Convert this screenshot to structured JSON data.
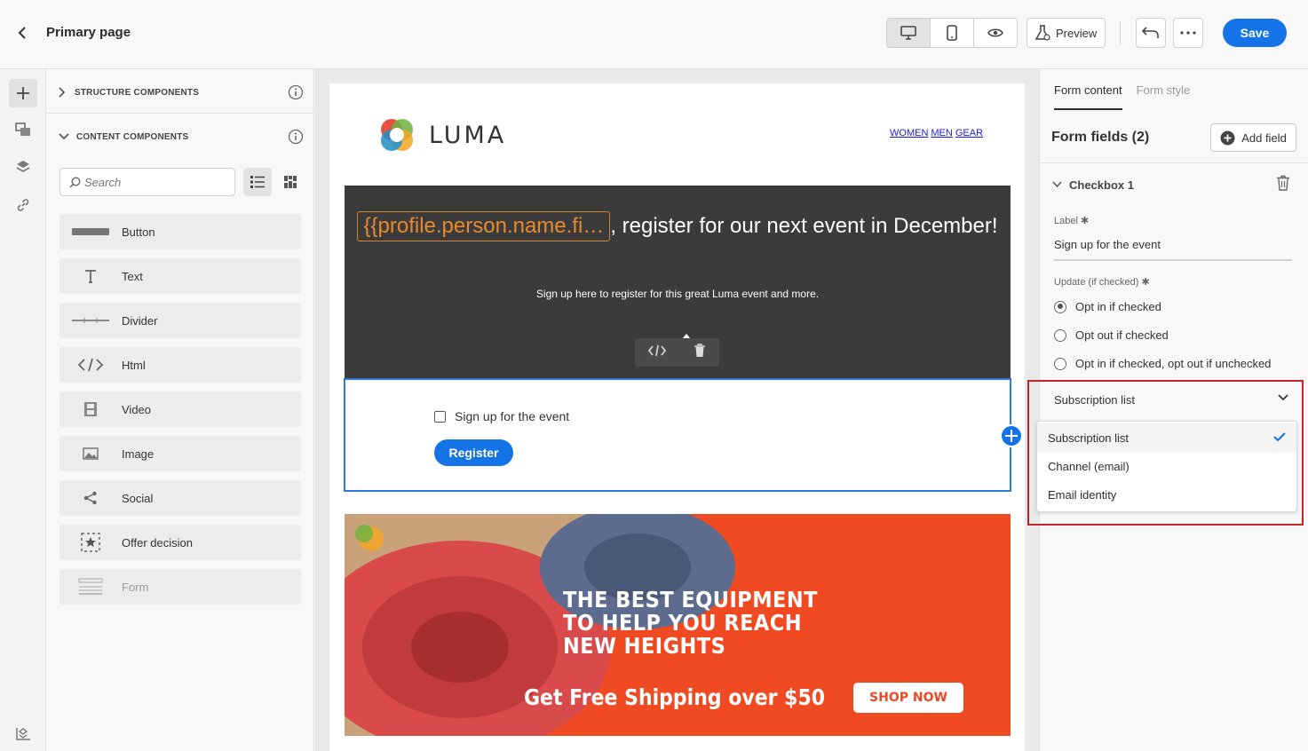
{
  "header": {
    "page_title": "Primary page",
    "preview_label": "Preview",
    "save_label": "Save"
  },
  "components_panel": {
    "structure_label": "STRUCTURE COMPONENTS",
    "content_label": "CONTENT COMPONENTS",
    "search_placeholder": "Search",
    "items": [
      {
        "label": "Button",
        "icon": "button-icon"
      },
      {
        "label": "Text",
        "icon": "text-icon"
      },
      {
        "label": "Divider",
        "icon": "divider-icon"
      },
      {
        "label": "Html",
        "icon": "html-icon"
      },
      {
        "label": "Video",
        "icon": "video-icon"
      },
      {
        "label": "Image",
        "icon": "image-icon"
      },
      {
        "label": "Social",
        "icon": "share-icon"
      },
      {
        "label": "Offer decision",
        "icon": "offer-decision-icon"
      },
      {
        "label": "Form",
        "icon": "form-icon",
        "disabled": true
      }
    ]
  },
  "email": {
    "brand": "LUMA",
    "nav": [
      "WOMEN",
      "MEN",
      "GEAR"
    ],
    "hero": {
      "token": "{{profile.person.name.fi…",
      "title_rest": ", register for our next event in December!",
      "subtitle": "Sign up here to register for this great Luma event and more."
    },
    "form": {
      "checkbox_label": "Sign up for the event",
      "button_label": "Register"
    },
    "banner": {
      "line1": "THE BEST EQUIPMENT",
      "line2": "TO HELP YOU REACH",
      "line3": "NEW HEIGHTS",
      "shipping": "Get Free Shipping over $50",
      "cta": "SHOP NOW"
    }
  },
  "properties": {
    "tabs": [
      "Form content",
      "Form style"
    ],
    "form_fields_title": "Form fields (2)",
    "add_field_label": "Add field",
    "checkbox_section": "Checkbox 1",
    "label_caption": "Label",
    "label_value": "Sign up for the event",
    "update_caption": "Update (if checked)",
    "radio_options": [
      "Opt in if checked",
      "Opt out if checked",
      "Opt in if checked, opt out if unchecked"
    ],
    "selected_radio": 0,
    "select_value": "Subscription list",
    "dropdown_options": [
      "Subscription list",
      "Channel (email)",
      "Email identity"
    ],
    "dropdown_selected": 0
  },
  "colors": {
    "accent": "#1473e6",
    "highlight": "#c22626",
    "token": "#e88a2c"
  }
}
